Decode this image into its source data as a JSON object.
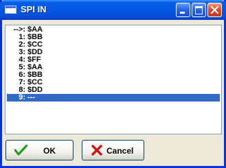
{
  "window": {
    "title": "SPI IN"
  },
  "list": {
    "rows": [
      {
        "index": "-->:",
        "value": "$AA"
      },
      {
        "index": "1:",
        "value": "$BB"
      },
      {
        "index": "2:",
        "value": "$CC"
      },
      {
        "index": "3:",
        "value": "$DD"
      },
      {
        "index": "4:",
        "value": "$FF"
      },
      {
        "index": "5:",
        "value": "$AA"
      },
      {
        "index": "6:",
        "value": "$BB"
      },
      {
        "index": "7:",
        "value": "$CC"
      },
      {
        "index": "8:",
        "value": "$DD"
      },
      {
        "index": "9:",
        "value": "---"
      }
    ],
    "selected_index": 9
  },
  "buttons": {
    "ok_label": "OK",
    "cancel_label": "Cancel"
  },
  "colors": {
    "titlebar": "#0058e6",
    "selection": "#316ac5",
    "ok_check": "#1b9e1b",
    "cancel_x": "#d01010"
  },
  "icons": {
    "title": "window-icon",
    "ok": "checkmark-icon",
    "cancel": "x-icon"
  }
}
